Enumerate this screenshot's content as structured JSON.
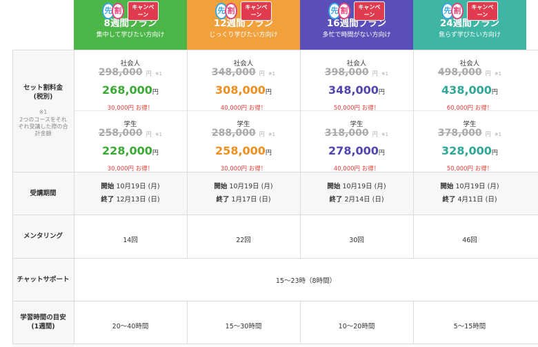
{
  "plans": [
    {
      "color": "#4cb748",
      "price_color": "#3aa935",
      "badge_a": "先",
      "badge_b": "割",
      "campaign": "キャンペーン",
      "name": "8週間プラン",
      "sub": "集中して学びたい方向け",
      "shakai_label": "社会人",
      "shakai_orig": "298,000",
      "shakai_price": "268,000",
      "shakai_save": "30,000円 お得！",
      "gakusei_label": "学生",
      "gakusei_orig": "258,000",
      "gakusei_price": "228,000",
      "gakusei_save": "30,000円 お得！",
      "start_label": "開始",
      "start": "10月19日 (月)",
      "end_label": "終了",
      "end": "12月13日 (日)",
      "mentoring": "14回",
      "study": "20〜40時間"
    },
    {
      "color": "#f0a13c",
      "price_color": "#ef8f1d",
      "badge_a": "先",
      "badge_b": "割",
      "campaign": "キャンペーン",
      "name": "12週間プラン",
      "sub": "じっくり学びたい方向け",
      "shakai_label": "社会人",
      "shakai_orig": "348,000",
      "shakai_price": "308,000",
      "shakai_save": "40,000円 お得！",
      "gakusei_label": "学生",
      "gakusei_orig": "288,000",
      "gakusei_price": "258,000",
      "gakusei_save": "30,000円 お得！",
      "start_label": "開始",
      "start": "10月19日 (月)",
      "end_label": "終了",
      "end": "1月17日 (日)",
      "mentoring": "22回",
      "study": "15〜30時間"
    },
    {
      "color": "#5a4fb8",
      "price_color": "#4f45ad",
      "badge_a": "先",
      "badge_b": "割",
      "campaign": "キャンペーン",
      "name": "16週間プラン",
      "sub": "多忙で時間がない方向け",
      "shakai_label": "社会人",
      "shakai_orig": "398,000",
      "shakai_price": "348,000",
      "shakai_save": "50,000円 お得！",
      "gakusei_label": "学生",
      "gakusei_orig": "318,000",
      "gakusei_price": "278,000",
      "gakusei_save": "40,000円 お得！",
      "start_label": "開始",
      "start": "10月19日 (月)",
      "end_label": "終了",
      "end": "2月14日 (日)",
      "mentoring": "30回",
      "study": "10〜20時間"
    },
    {
      "color": "#3fb5a3",
      "price_color": "#2fa794",
      "badge_a": "先",
      "badge_b": "割",
      "campaign": "キャンペーン",
      "name": "24週間プラン",
      "sub": "焦らず学びたい方向け",
      "shakai_label": "社会人",
      "shakai_orig": "498,000",
      "shakai_price": "438,000",
      "shakai_save": "60,000円 お得！",
      "gakusei_label": "学生",
      "gakusei_orig": "378,000",
      "gakusei_price": "328,000",
      "gakusei_save": "50,000円 お得！",
      "start_label": "開始",
      "start": "10月19日 (月)",
      "end_label": "終了",
      "end": "4月11日 (日)",
      "mentoring": "46回",
      "study": "5〜15時間"
    }
  ],
  "labels": {
    "set_price": "セット割料金\n(税別)",
    "note_mark": "※1",
    "note": "2つのコースをそれぞれ受講した際の合計金額",
    "period": "受講期間",
    "mentoring": "メンタリング",
    "chat": "チャットサポート",
    "study": "学習時間の目安\n(1週間)"
  },
  "common": {
    "yen": "円",
    "note_ref": "※1",
    "chat_value": "15〜23時（8時間）"
  }
}
